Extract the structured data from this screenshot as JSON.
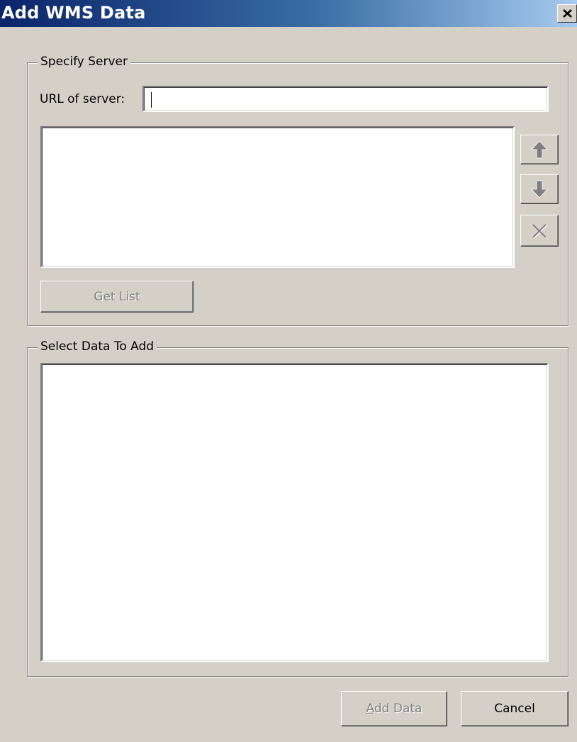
{
  "window": {
    "title": "Add WMS Data",
    "close_icon": "close-icon"
  },
  "specify_server": {
    "legend": "Specify Server",
    "url_label": "URL of server:",
    "url_value": "",
    "server_list_items": [],
    "move_up_icon": "arrow-up-icon",
    "move_down_icon": "arrow-down-icon",
    "delete_icon": "delete-x-icon",
    "get_list_label": "Get List",
    "get_list_enabled": false
  },
  "select_data": {
    "legend": "Select Data To Add",
    "layer_items": []
  },
  "footer": {
    "add_data_mnemonic": "A",
    "add_data_rest": "dd Data",
    "add_data_enabled": false,
    "cancel_label": "Cancel"
  },
  "colors": {
    "dialog_bg": "#d4d0c8",
    "title_gradient_start": "#0a246a",
    "title_gradient_end": "#a6caf0",
    "disabled_text": "#808080"
  }
}
